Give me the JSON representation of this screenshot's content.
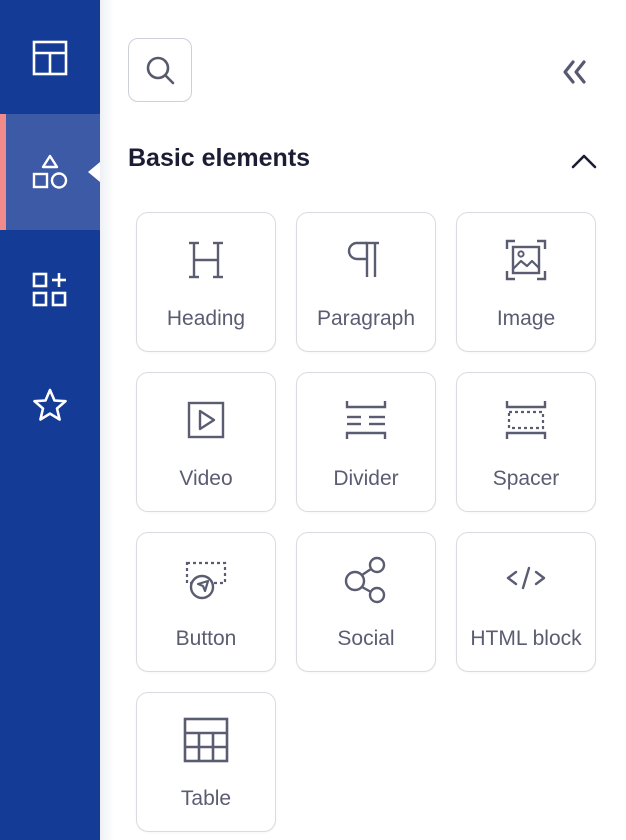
{
  "sidebar": {
    "items": [
      {
        "name": "layout",
        "icon": "layout-icon",
        "active": false
      },
      {
        "name": "elements",
        "icon": "shapes-icon",
        "active": true
      },
      {
        "name": "blocks",
        "icon": "add-block-icon",
        "active": false
      },
      {
        "name": "favorites",
        "icon": "star-icon",
        "active": false
      }
    ],
    "colors": {
      "background": "#143c96",
      "active_background": "#3d5aa6",
      "accent": "#ef8b8b"
    }
  },
  "panel": {
    "search_icon": "search-icon",
    "collapse_icon": "double-chevron-left-icon",
    "section": {
      "title": "Basic elements",
      "toggle_icon": "chevron-up-icon",
      "expanded": true
    },
    "tiles": [
      {
        "label": "Heading",
        "icon": "heading-icon"
      },
      {
        "label": "Paragraph",
        "icon": "paragraph-icon"
      },
      {
        "label": "Image",
        "icon": "image-icon"
      },
      {
        "label": "Video",
        "icon": "video-icon"
      },
      {
        "label": "Divider",
        "icon": "divider-icon"
      },
      {
        "label": "Spacer",
        "icon": "spacer-icon"
      },
      {
        "label": "Button",
        "icon": "button-icon"
      },
      {
        "label": "Social",
        "icon": "social-icon"
      },
      {
        "label": "HTML block",
        "icon": "code-icon"
      },
      {
        "label": "Table",
        "icon": "table-icon"
      }
    ]
  }
}
